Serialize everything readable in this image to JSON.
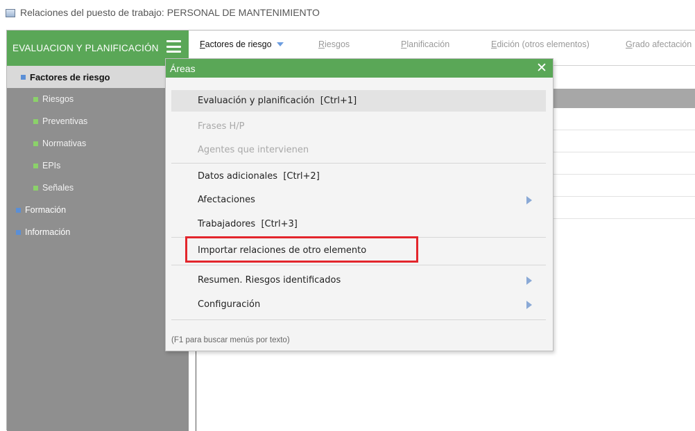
{
  "window": {
    "title": "Relaciones del puesto de trabajo: PERSONAL DE MANTENIMIENTO"
  },
  "sidebar": {
    "header": "EVALUACION Y PLANIFICACIÓN",
    "items": [
      {
        "label": "Factores de riesgo",
        "level": 1,
        "active": true
      },
      {
        "label": "Riesgos",
        "level": 2
      },
      {
        "label": "Preventivas",
        "level": 2
      },
      {
        "label": "Normativas",
        "level": 2
      },
      {
        "label": "EPIs",
        "level": 2
      },
      {
        "label": "Señales",
        "level": 2
      },
      {
        "label": "Formación",
        "level": 1
      },
      {
        "label": "Información",
        "level": 1
      }
    ]
  },
  "toolbar": {
    "tabs": [
      {
        "first": "F",
        "rest": "actores de riesgo",
        "active": true
      },
      {
        "first": "R",
        "rest": "iesgos"
      },
      {
        "first": "P",
        "rest": "lanificación"
      },
      {
        "first": "E",
        "rest": "dición (otros elementos)"
      },
      {
        "first": "G",
        "rest": "rado afectación"
      }
    ]
  },
  "menu": {
    "title": "Áreas",
    "items": [
      {
        "label": "Evaluación y planificación  [Ctrl+1]",
        "highlighted": true
      },
      {
        "label": "Frases H/P",
        "disabled": true
      },
      {
        "label": "Agentes que intervienen",
        "disabled": true
      },
      {
        "label": "Datos adicionales  [Ctrl+2]"
      },
      {
        "label": "Afectaciones",
        "submenu": true
      },
      {
        "label": "Trabajadores  [Ctrl+3]"
      },
      {
        "label": "Importar relaciones de otro elemento",
        "emphasized": true
      },
      {
        "label": "Resumen. Riesgos identificados",
        "submenu": true
      },
      {
        "label": "Configuración",
        "submenu": true
      }
    ],
    "footer": "(F1 para buscar menús por texto)"
  },
  "colors": {
    "green": "#5aa757",
    "sidebar_gray": "#8f8f8f",
    "highlight_red": "#e3262c",
    "icon_blue": "#5b8fd6",
    "icon_green": "#8bd16a"
  }
}
